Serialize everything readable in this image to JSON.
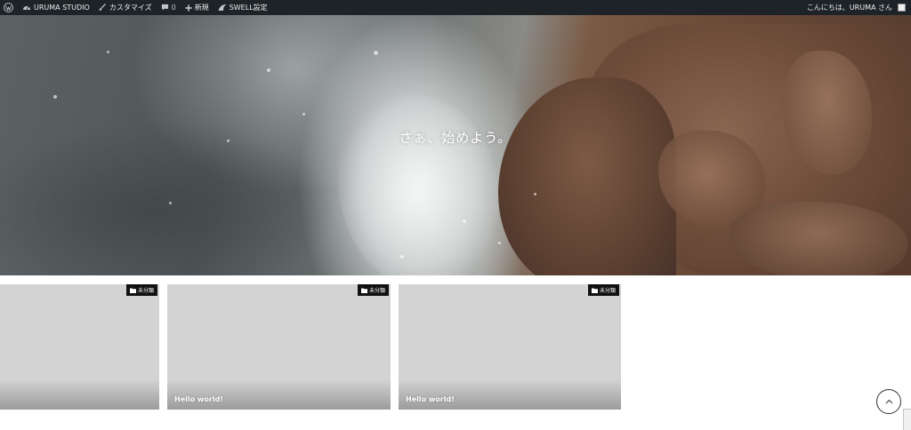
{
  "admin_bar": {
    "site_name": "URUMA STUDIO",
    "customize": "カスタマイズ",
    "comments_count": "0",
    "new": "新規",
    "swell_settings": "SWELL設定",
    "greeting": "こんにちは、URUMA さん"
  },
  "hero": {
    "title": "さぁ、始めよう。"
  },
  "posts": [
    {
      "category": "未分類",
      "title": ""
    },
    {
      "category": "未分類",
      "title": "Hello world!"
    },
    {
      "category": "未分類",
      "title": "Hello world!"
    }
  ],
  "colors": {
    "admin_bar_bg": "#1d2327",
    "card_placeholder": "#d3d3d3",
    "category_badge_bg": "#111111"
  },
  "icons": {
    "wp_logo": "wordpress-icon",
    "site": "dashboard-icon",
    "customize": "brush-icon",
    "comments": "comment-icon",
    "new": "plus-icon",
    "swell": "swell-icon",
    "category": "folder-icon",
    "back_to_top": "chevron-up-icon"
  }
}
